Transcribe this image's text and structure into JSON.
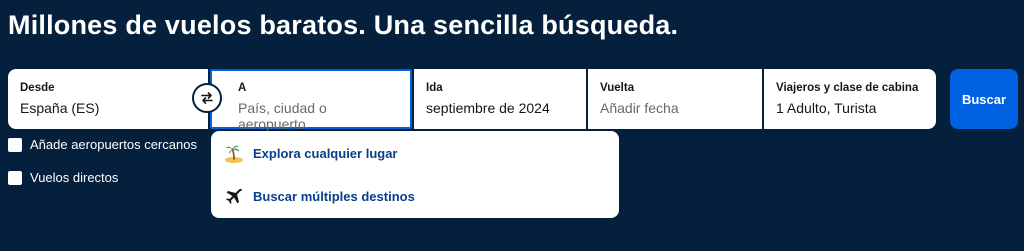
{
  "headline": "Millones de vuelos baratos. Una sencilla búsqueda.",
  "search": {
    "from": {
      "label": "Desde",
      "value": "España (ES)"
    },
    "to": {
      "label": "A",
      "placeholder": "País, ciudad o aeropuerto"
    },
    "depart": {
      "label": "Ida",
      "value": "septiembre de 2024"
    },
    "return": {
      "label": "Vuelta",
      "placeholder": "Añadir fecha"
    },
    "travellers": {
      "label": "Viajeros y clase de cabina",
      "value": "1 Adulto, Turista"
    },
    "search_button": "Buscar",
    "swap_icon": "swap-icon"
  },
  "options": {
    "nearby_airports": "Añade aeropuertos cercanos",
    "direct_flights": "Vuelos directos"
  },
  "dropdown": {
    "items": [
      {
        "label": "Explora cualquier lugar",
        "icon": "island-icon"
      },
      {
        "label": "Buscar múltiples destinos",
        "icon": "plane-icon"
      }
    ]
  },
  "colors": {
    "background": "#05203c",
    "accent": "#0062e3",
    "link": "#0b3e8c"
  }
}
